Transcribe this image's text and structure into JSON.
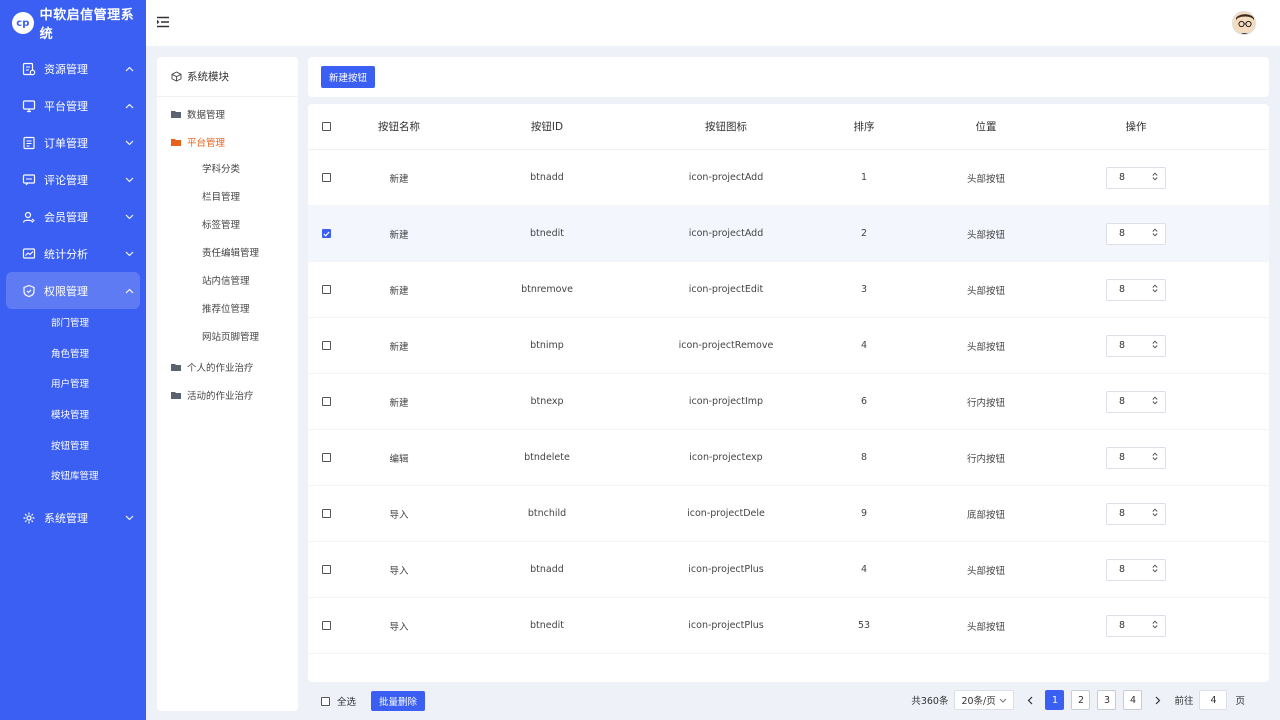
{
  "app": {
    "title": "中软启信管理系统",
    "logo_mark": "cp",
    "accent": "#3b5ff2",
    "active_tree": "#e8621b"
  },
  "sidebar": {
    "groups": [
      {
        "label": "资源管理",
        "icon": "resource-icon",
        "expanded": true
      },
      {
        "label": "平台管理",
        "icon": "platform-icon",
        "expanded": true
      },
      {
        "label": "订单管理",
        "icon": "order-icon",
        "expanded": false
      },
      {
        "label": "评论管理",
        "icon": "comment-icon",
        "expanded": false
      },
      {
        "label": "会员管理",
        "icon": "member-icon",
        "expanded": false
      },
      {
        "label": "统计分析",
        "icon": "stats-icon",
        "expanded": false
      },
      {
        "label": "权限管理",
        "icon": "shield-icon",
        "expanded": true,
        "active": true
      },
      {
        "label": "系统管理",
        "icon": "gear-icon",
        "expanded": false
      }
    ],
    "sub_items": [
      "部门管理",
      "角色管理",
      "用户管理",
      "模块管理",
      "按钮管理",
      "按钮库管理"
    ]
  },
  "tree": {
    "title": "系统模块",
    "nodes": [
      {
        "label": "数据管理"
      },
      {
        "label": "平台管理",
        "active": true
      },
      {
        "label": "个人的作业治疗"
      },
      {
        "label": "活动的作业治疗"
      }
    ],
    "children": [
      "学科分类",
      "栏目管理",
      "标签管理",
      "责任编辑管理",
      "站内信管理",
      "推荐位管理",
      "网站页脚管理"
    ]
  },
  "toolbar": {
    "new_button": "新建按钮"
  },
  "table": {
    "headers": {
      "name": "按钮名称",
      "id": "按钮ID",
      "icon": "按钮图标",
      "sort": "排序",
      "position": "位置",
      "op": "操作"
    },
    "rows": [
      {
        "name": "新建",
        "id": "btnadd",
        "icon": "icon-projectAdd",
        "sort": "1",
        "position": "头部按钮",
        "op": "8",
        "checked": false
      },
      {
        "name": "新建",
        "id": "btnedit",
        "icon": "icon-projectAdd",
        "sort": "2",
        "position": "头部按钮",
        "op": "8",
        "checked": true
      },
      {
        "name": "新建",
        "id": "btnremove",
        "icon": "icon-projectEdit",
        "sort": "3",
        "position": "头部按钮",
        "op": "8",
        "checked": false
      },
      {
        "name": "新建",
        "id": "btnimp",
        "icon": "icon-projectRemove",
        "sort": "4",
        "position": "头部按钮",
        "op": "8",
        "checked": false
      },
      {
        "name": "新建",
        "id": "btnexp",
        "icon": "icon-projectImp",
        "sort": "6",
        "position": "行内按钮",
        "op": "8",
        "checked": false
      },
      {
        "name": "编辑",
        "id": "btndelete",
        "icon": "icon-projectexp",
        "sort": "8",
        "position": "行内按钮",
        "op": "8",
        "checked": false
      },
      {
        "name": "导入",
        "id": "btnchild",
        "icon": "icon-projectDele",
        "sort": "9",
        "position": "底部按钮",
        "op": "8",
        "checked": false
      },
      {
        "name": "导入",
        "id": "btnadd",
        "icon": "icon-projectPlus",
        "sort": "4",
        "position": "头部按钮",
        "op": "8",
        "checked": false
      },
      {
        "name": "导入",
        "id": "btnedit",
        "icon": "icon-projectPlus",
        "sort": "53",
        "position": "头部按钮",
        "op": "8",
        "checked": false
      }
    ]
  },
  "footer": {
    "select_all": "全选",
    "batch_delete": "批量删除",
    "total": "共360条",
    "page_size": "20条/页",
    "pages": [
      "1",
      "2",
      "3",
      "4"
    ],
    "current_page": "1",
    "goto_label": "前往",
    "goto_value": "4",
    "goto_suffix": "页"
  }
}
